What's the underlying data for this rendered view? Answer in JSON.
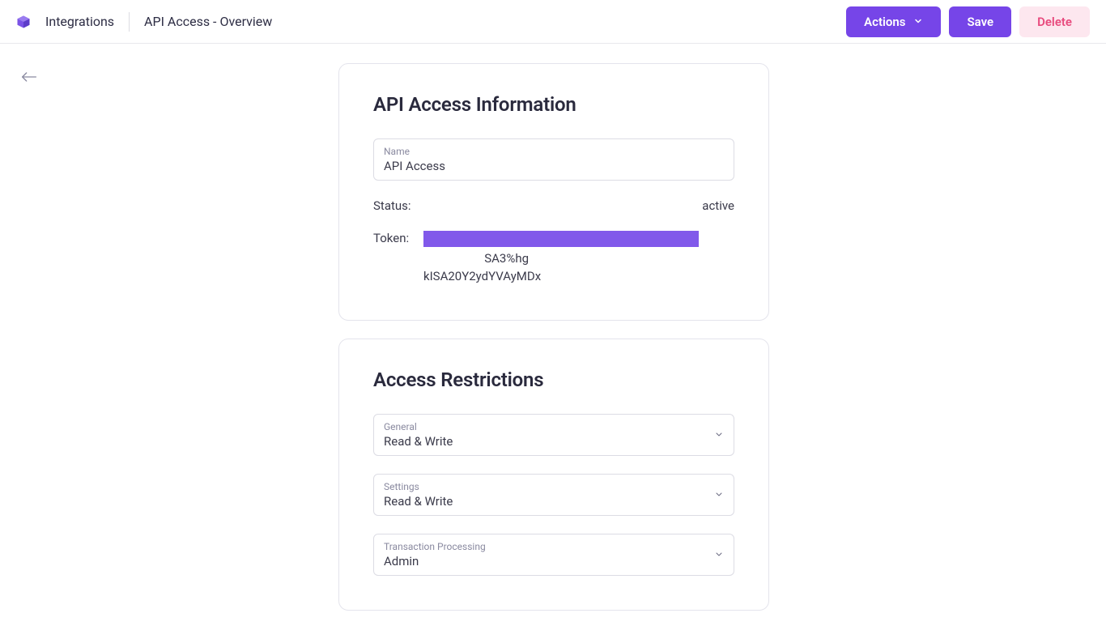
{
  "header": {
    "breadcrumb": "Integrations",
    "title": "API Access - Overview",
    "actions_label": "Actions",
    "save_label": "Save",
    "delete_label": "Delete"
  },
  "info_card": {
    "heading": "API Access Information",
    "name_label": "Name",
    "name_value": "API Access",
    "status_label": "Status:",
    "status_value": "active",
    "token_label": "Token:",
    "token_tail": "SA3%hg",
    "token_line2": "kISA20Y2ydYVAyMDx"
  },
  "restrictions_card": {
    "heading": "Access Restrictions",
    "items": [
      {
        "label": "General",
        "value": "Read & Write"
      },
      {
        "label": "Settings",
        "value": "Read & Write"
      },
      {
        "label": "Transaction Processing",
        "value": "Admin"
      }
    ]
  }
}
